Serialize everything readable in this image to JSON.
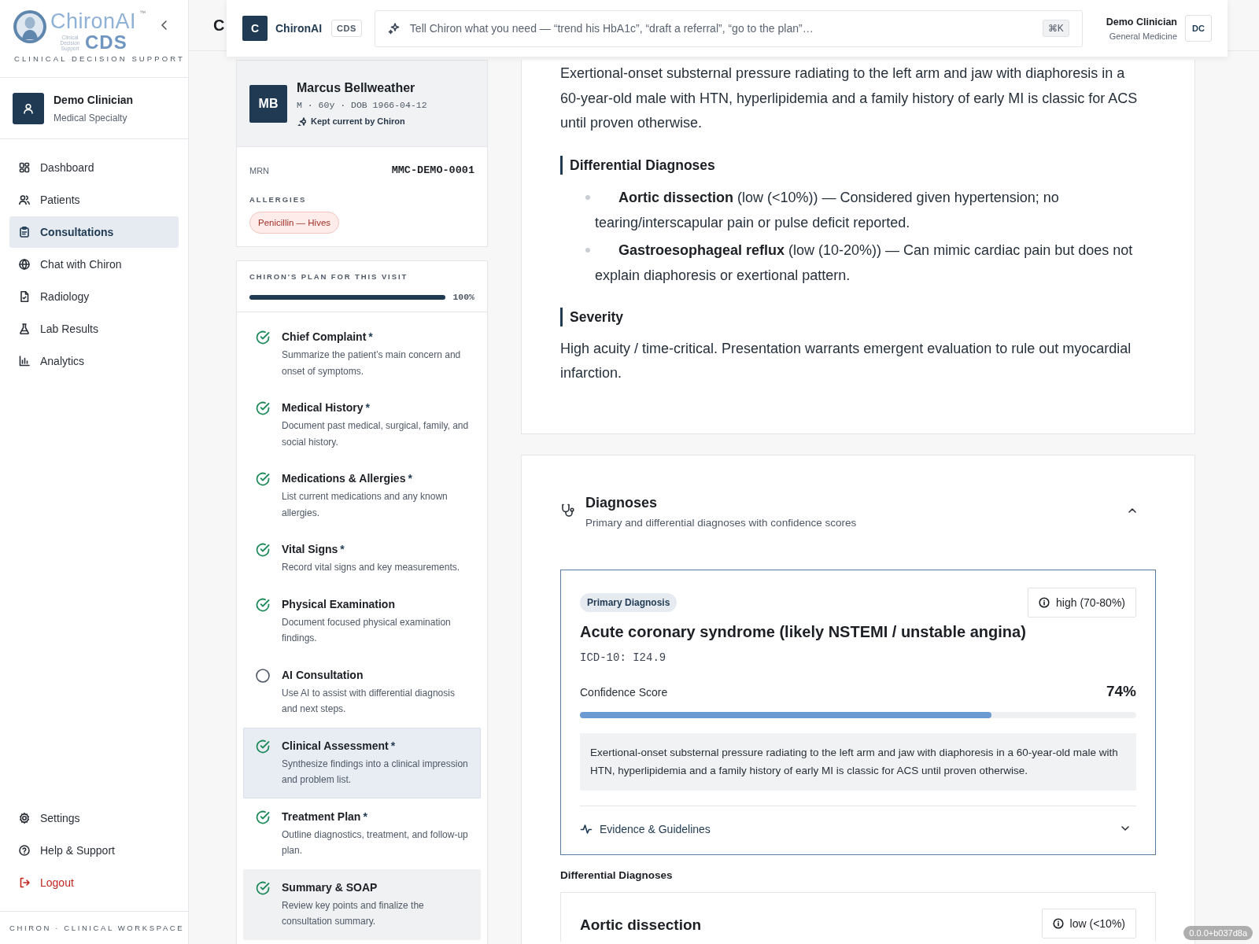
{
  "sidebar": {
    "logo": {
      "wordmark": "ChironAI",
      "trademark": "™",
      "caption": "Clinical Decision Support",
      "product": "CDS",
      "tagline": "CLINICAL DECISION SUPPORT"
    },
    "user": {
      "name": "Demo Clinician",
      "role": "Medical Specialty"
    },
    "nav": [
      {
        "label": "Dashboard",
        "selected": false
      },
      {
        "label": "Patients",
        "selected": false
      },
      {
        "label": "Consultations",
        "selected": true
      },
      {
        "label": "Chat with Chiron",
        "selected": false
      },
      {
        "label": "Radiology",
        "selected": false
      },
      {
        "label": "Lab Results",
        "selected": false
      },
      {
        "label": "Analytics",
        "selected": false
      }
    ],
    "footer_nav": [
      {
        "label": "Settings",
        "kind": "normal"
      },
      {
        "label": "Help & Support",
        "kind": "normal"
      },
      {
        "label": "Logout",
        "kind": "danger"
      }
    ],
    "footer": "CHIRON · CLINICAL WORKSPACE"
  },
  "page_title": "C",
  "topbar": {
    "brand_initial": "C",
    "brand": "ChironAI",
    "badge": "CDS",
    "command": {
      "placeholder": "Tell Chiron what you need — “trend his HbA1c”, “draft a referral”, “go to the plan”…",
      "shortcut": "⌘K"
    },
    "user": {
      "name": "Demo Clinician",
      "role": "General Medicine",
      "initials": "DC"
    }
  },
  "patient": {
    "initials": "MB",
    "name": "Marcus Bellweather",
    "details": "M · 60y · DOB 1966-04-12",
    "sync_note": "Kept current by Chiron",
    "mrn_label": "MRN",
    "mrn": "MMC-DEMO-0001",
    "allergies_label": "ALLERGIES",
    "allergies": [
      "Penicillin — Hives"
    ]
  },
  "plan": {
    "title": "CHIRON'S PLAN FOR THIS VISIT",
    "level": 1,
    "reading": "100%",
    "steps": [
      {
        "title": "Chief Complaint",
        "required_mark": "*",
        "description": "Summarize the patient’s main concern and onset of symptoms.",
        "done": true,
        "selected": false,
        "hovered": false
      },
      {
        "title": "Medical History",
        "required_mark": "*",
        "description": "Document past medical, surgical, family, and social history.",
        "done": true,
        "selected": false,
        "hovered": false
      },
      {
        "title": "Medications & Allergies",
        "required_mark": "*",
        "description": "List current medications and any known allergies.",
        "done": true,
        "selected": false,
        "hovered": false
      },
      {
        "title": "Vital Signs",
        "required_mark": "*",
        "description": "Record vital signs and key measurements.",
        "done": true,
        "selected": false,
        "hovered": false
      },
      {
        "title": "Physical Examination",
        "description": "Document focused physical examination findings.",
        "done": true,
        "selected": false,
        "hovered": false
      },
      {
        "title": "AI Consultation",
        "description": "Use AI to assist with differential diagnosis and next steps.",
        "done": false,
        "selected": false,
        "hovered": false
      },
      {
        "title": "Clinical Assessment",
        "required_mark": "*",
        "description": "Synthesize findings into a clinical impression and problem list.",
        "done": true,
        "selected": true,
        "hovered": false
      },
      {
        "title": "Treatment Plan",
        "required_mark": "*",
        "description": "Outline diagnostics, treatment, and follow-up plan.",
        "done": true,
        "selected": false,
        "hovered": false
      },
      {
        "title": "Summary & SOAP",
        "description": "Review key points and finalize the consultation summary.",
        "done": true,
        "selected": false,
        "hovered": true
      }
    ]
  },
  "assessment": {
    "blocks": [
      {
        "kind": "paragraph",
        "text": "Exertional-onset substernal pressure radiating to the left arm and jaw with diaphoresis in a 60-year-old male with HTN, hyperlipidemia and a family history of early MI is classic for ACS until proven otherwise."
      },
      {
        "kind": "heading",
        "text": "Differential Diagnoses"
      },
      {
        "kind": "list",
        "items": [
          "**Aortic dissection** (low (<10%)) — Considered given hypertension; no tearing/interscapular pain or pulse deficit reported.",
          "**Gastroesophageal reflux** (low (10-20%)) — Can mimic cardiac pain but does not explain diaphoresis or exertional pattern."
        ]
      },
      {
        "kind": "heading",
        "text": "Severity"
      },
      {
        "kind": "paragraph",
        "text": "High acuity / time-critical. Presentation warrants emergent evaluation to rule out myocardial infarction."
      }
    ]
  },
  "diagnoses": {
    "title": "Diagnoses",
    "subtitle": "Primary and differential diagnoses with confidence scores",
    "expanded": true,
    "primary": {
      "tag": "Primary Diagnosis",
      "confidence_label": "high (70-80%)",
      "name": "Acute coronary syndrome (likely NSTEMI / unstable angina)",
      "code": "ICD-10: I24.9",
      "score_label": "Confidence Score",
      "score": "74%",
      "level": 0.74,
      "rationale": "Exertional-onset substernal pressure radiating to the left arm and jaw with diaphoresis in a 60-year-old male with HTN, hyperlipidemia and a family history of early MI is classic for ACS until proven otherwise.",
      "evidence": {
        "label": "Evidence & Guidelines",
        "expanded": false
      }
    },
    "differential_title": "Differential Diagnoses",
    "differentials": [
      {
        "name": "Aortic dissection",
        "confidence_label": "low (<10%)"
      }
    ]
  },
  "version": "0.0.0+b037d8a"
}
